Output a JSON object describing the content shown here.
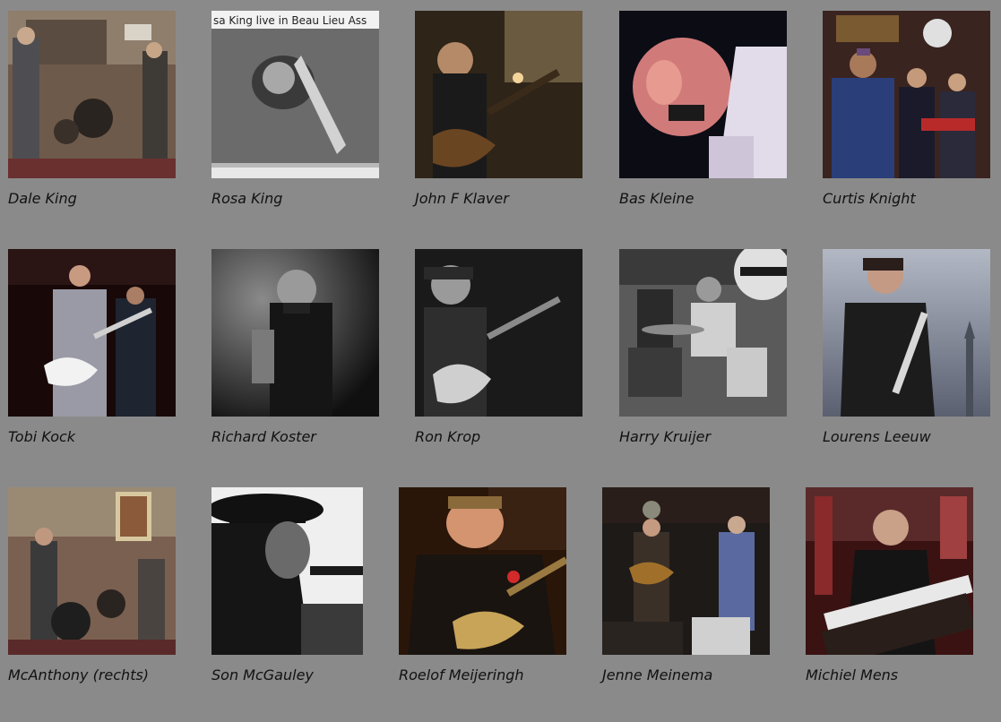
{
  "musicians": [
    {
      "name": "Dale King",
      "image": "band-photo"
    },
    {
      "name": "Rosa King",
      "image": "newspaper-saxophone-photo",
      "photo_caption_text": "sa King live in Beau Lieu Ass"
    },
    {
      "name": "John F Klaver",
      "image": "guitarist-photo"
    },
    {
      "name": "Bas Kleine",
      "image": "harmonica-player-photo"
    },
    {
      "name": "Curtis Knight",
      "image": "band-stage-photo"
    },
    {
      "name": "Tobi Kock",
      "image": "guitarist-photo"
    },
    {
      "name": "Richard Koster",
      "image": "harmonica-player-photo"
    },
    {
      "name": "Ron Krop",
      "image": "guitarist-photo"
    },
    {
      "name": "Harry Kruijer",
      "image": "drummer-photo"
    },
    {
      "name": "Lourens Leeuw",
      "image": "bassist-photo"
    },
    {
      "name": "McAnthony (rechts)",
      "image": "band-photo"
    },
    {
      "name": "Son McGauley",
      "image": "singer-microphone-photo"
    },
    {
      "name": "Roelof Meijeringh",
      "image": "guitarist-photo"
    },
    {
      "name": "Jenne Meinema",
      "image": "band-stage-photo"
    },
    {
      "name": "Michiel Mens",
      "image": "keyboard-player-photo"
    }
  ]
}
